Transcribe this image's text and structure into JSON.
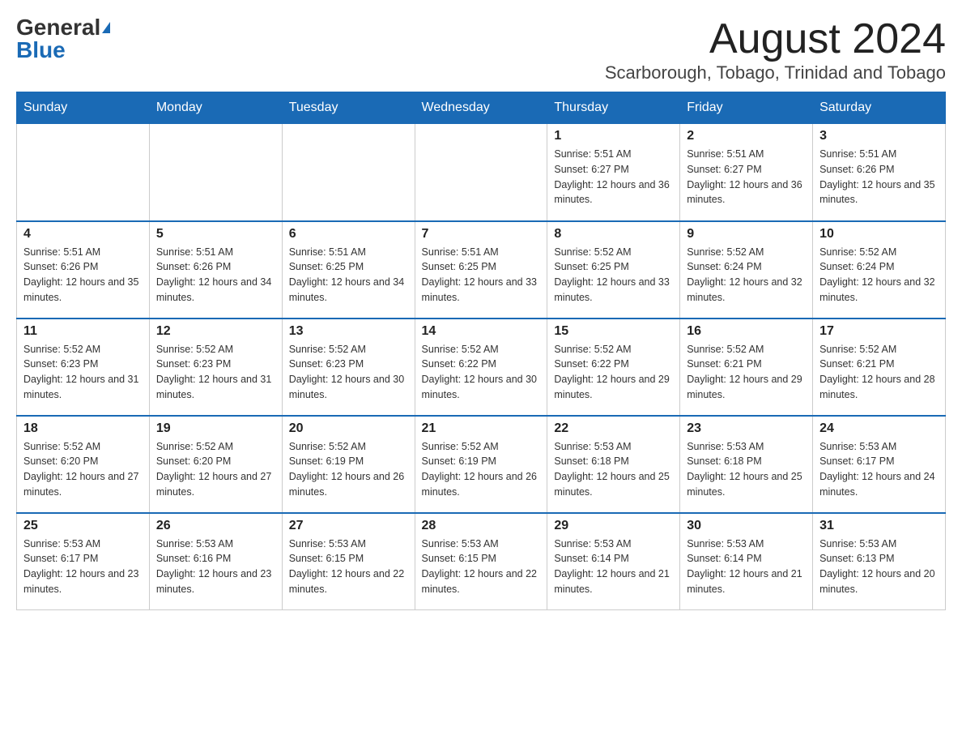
{
  "logo": {
    "general": "General",
    "blue": "Blue"
  },
  "title": "August 2024",
  "location": "Scarborough, Tobago, Trinidad and Tobago",
  "days_of_week": [
    "Sunday",
    "Monday",
    "Tuesday",
    "Wednesday",
    "Thursday",
    "Friday",
    "Saturday"
  ],
  "weeks": [
    [
      {
        "day": "",
        "sunrise": "",
        "sunset": "",
        "daylight": ""
      },
      {
        "day": "",
        "sunrise": "",
        "sunset": "",
        "daylight": ""
      },
      {
        "day": "",
        "sunrise": "",
        "sunset": "",
        "daylight": ""
      },
      {
        "day": "",
        "sunrise": "",
        "sunset": "",
        "daylight": ""
      },
      {
        "day": "1",
        "sunrise": "Sunrise: 5:51 AM",
        "sunset": "Sunset: 6:27 PM",
        "daylight": "Daylight: 12 hours and 36 minutes."
      },
      {
        "day": "2",
        "sunrise": "Sunrise: 5:51 AM",
        "sunset": "Sunset: 6:27 PM",
        "daylight": "Daylight: 12 hours and 36 minutes."
      },
      {
        "day": "3",
        "sunrise": "Sunrise: 5:51 AM",
        "sunset": "Sunset: 6:26 PM",
        "daylight": "Daylight: 12 hours and 35 minutes."
      }
    ],
    [
      {
        "day": "4",
        "sunrise": "Sunrise: 5:51 AM",
        "sunset": "Sunset: 6:26 PM",
        "daylight": "Daylight: 12 hours and 35 minutes."
      },
      {
        "day": "5",
        "sunrise": "Sunrise: 5:51 AM",
        "sunset": "Sunset: 6:26 PM",
        "daylight": "Daylight: 12 hours and 34 minutes."
      },
      {
        "day": "6",
        "sunrise": "Sunrise: 5:51 AM",
        "sunset": "Sunset: 6:25 PM",
        "daylight": "Daylight: 12 hours and 34 minutes."
      },
      {
        "day": "7",
        "sunrise": "Sunrise: 5:51 AM",
        "sunset": "Sunset: 6:25 PM",
        "daylight": "Daylight: 12 hours and 33 minutes."
      },
      {
        "day": "8",
        "sunrise": "Sunrise: 5:52 AM",
        "sunset": "Sunset: 6:25 PM",
        "daylight": "Daylight: 12 hours and 33 minutes."
      },
      {
        "day": "9",
        "sunrise": "Sunrise: 5:52 AM",
        "sunset": "Sunset: 6:24 PM",
        "daylight": "Daylight: 12 hours and 32 minutes."
      },
      {
        "day": "10",
        "sunrise": "Sunrise: 5:52 AM",
        "sunset": "Sunset: 6:24 PM",
        "daylight": "Daylight: 12 hours and 32 minutes."
      }
    ],
    [
      {
        "day": "11",
        "sunrise": "Sunrise: 5:52 AM",
        "sunset": "Sunset: 6:23 PM",
        "daylight": "Daylight: 12 hours and 31 minutes."
      },
      {
        "day": "12",
        "sunrise": "Sunrise: 5:52 AM",
        "sunset": "Sunset: 6:23 PM",
        "daylight": "Daylight: 12 hours and 31 minutes."
      },
      {
        "day": "13",
        "sunrise": "Sunrise: 5:52 AM",
        "sunset": "Sunset: 6:23 PM",
        "daylight": "Daylight: 12 hours and 30 minutes."
      },
      {
        "day": "14",
        "sunrise": "Sunrise: 5:52 AM",
        "sunset": "Sunset: 6:22 PM",
        "daylight": "Daylight: 12 hours and 30 minutes."
      },
      {
        "day": "15",
        "sunrise": "Sunrise: 5:52 AM",
        "sunset": "Sunset: 6:22 PM",
        "daylight": "Daylight: 12 hours and 29 minutes."
      },
      {
        "day": "16",
        "sunrise": "Sunrise: 5:52 AM",
        "sunset": "Sunset: 6:21 PM",
        "daylight": "Daylight: 12 hours and 29 minutes."
      },
      {
        "day": "17",
        "sunrise": "Sunrise: 5:52 AM",
        "sunset": "Sunset: 6:21 PM",
        "daylight": "Daylight: 12 hours and 28 minutes."
      }
    ],
    [
      {
        "day": "18",
        "sunrise": "Sunrise: 5:52 AM",
        "sunset": "Sunset: 6:20 PM",
        "daylight": "Daylight: 12 hours and 27 minutes."
      },
      {
        "day": "19",
        "sunrise": "Sunrise: 5:52 AM",
        "sunset": "Sunset: 6:20 PM",
        "daylight": "Daylight: 12 hours and 27 minutes."
      },
      {
        "day": "20",
        "sunrise": "Sunrise: 5:52 AM",
        "sunset": "Sunset: 6:19 PM",
        "daylight": "Daylight: 12 hours and 26 minutes."
      },
      {
        "day": "21",
        "sunrise": "Sunrise: 5:52 AM",
        "sunset": "Sunset: 6:19 PM",
        "daylight": "Daylight: 12 hours and 26 minutes."
      },
      {
        "day": "22",
        "sunrise": "Sunrise: 5:53 AM",
        "sunset": "Sunset: 6:18 PM",
        "daylight": "Daylight: 12 hours and 25 minutes."
      },
      {
        "day": "23",
        "sunrise": "Sunrise: 5:53 AM",
        "sunset": "Sunset: 6:18 PM",
        "daylight": "Daylight: 12 hours and 25 minutes."
      },
      {
        "day": "24",
        "sunrise": "Sunrise: 5:53 AM",
        "sunset": "Sunset: 6:17 PM",
        "daylight": "Daylight: 12 hours and 24 minutes."
      }
    ],
    [
      {
        "day": "25",
        "sunrise": "Sunrise: 5:53 AM",
        "sunset": "Sunset: 6:17 PM",
        "daylight": "Daylight: 12 hours and 23 minutes."
      },
      {
        "day": "26",
        "sunrise": "Sunrise: 5:53 AM",
        "sunset": "Sunset: 6:16 PM",
        "daylight": "Daylight: 12 hours and 23 minutes."
      },
      {
        "day": "27",
        "sunrise": "Sunrise: 5:53 AM",
        "sunset": "Sunset: 6:15 PM",
        "daylight": "Daylight: 12 hours and 22 minutes."
      },
      {
        "day": "28",
        "sunrise": "Sunrise: 5:53 AM",
        "sunset": "Sunset: 6:15 PM",
        "daylight": "Daylight: 12 hours and 22 minutes."
      },
      {
        "day": "29",
        "sunrise": "Sunrise: 5:53 AM",
        "sunset": "Sunset: 6:14 PM",
        "daylight": "Daylight: 12 hours and 21 minutes."
      },
      {
        "day": "30",
        "sunrise": "Sunrise: 5:53 AM",
        "sunset": "Sunset: 6:14 PM",
        "daylight": "Daylight: 12 hours and 21 minutes."
      },
      {
        "day": "31",
        "sunrise": "Sunrise: 5:53 AM",
        "sunset": "Sunset: 6:13 PM",
        "daylight": "Daylight: 12 hours and 20 minutes."
      }
    ]
  ]
}
